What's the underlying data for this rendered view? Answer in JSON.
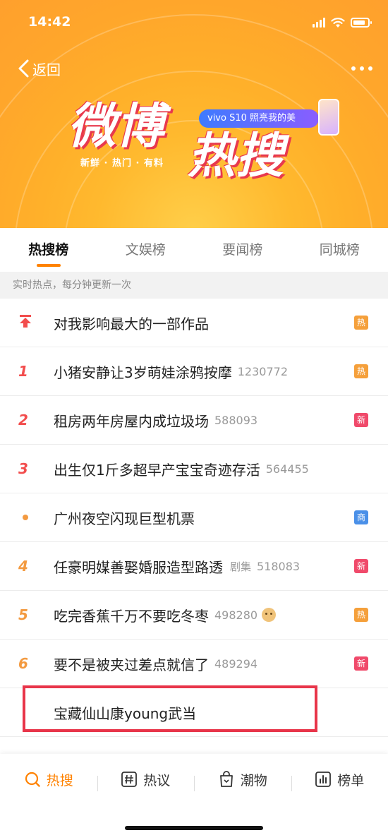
{
  "status_bar": {
    "time": "14:42"
  },
  "header": {
    "back_label": "返回",
    "logo_text_1": "微博",
    "logo_text_2": "热搜",
    "slogan": "新鲜 · 热门 · 有料",
    "ad_text": "vivo S10 照亮我的美"
  },
  "tabs": [
    {
      "label": "热搜榜",
      "active": true
    },
    {
      "label": "文娱榜",
      "active": false
    },
    {
      "label": "要闻榜",
      "active": false
    },
    {
      "label": "同城榜",
      "active": false
    }
  ],
  "subheader": "实时热点，每分钟更新一次",
  "items": [
    {
      "rank": "",
      "title": "对我影响最大的一部作品",
      "label": "",
      "count": "",
      "badge": "热",
      "badge_color": "#f5a03b"
    },
    {
      "rank": "1",
      "title": "小猪安静让3岁萌娃涂鸦按摩",
      "label": "",
      "count": "1230772",
      "badge": "热",
      "badge_color": "#f5a03b"
    },
    {
      "rank": "2",
      "title": "租房两年房屋内成垃圾场",
      "label": "",
      "count": "588093",
      "badge": "新",
      "badge_color": "#f04a6b"
    },
    {
      "rank": "3",
      "title": "出生仅1斤多超早产宝宝奇迹存活",
      "label": "",
      "count": "564455",
      "badge": "",
      "badge_color": ""
    },
    {
      "rank": "",
      "title": "广州夜空闪现巨型机票",
      "label": "",
      "count": "",
      "badge": "商",
      "badge_color": "#4a90e8"
    },
    {
      "rank": "4",
      "title": "任豪明媒善娶婚服造型路透",
      "label": "剧集",
      "count": "518083",
      "badge": "新",
      "badge_color": "#f04a6b"
    },
    {
      "rank": "5",
      "title": "吃完香蕉千万不要吃冬枣",
      "label": "",
      "count": "498280",
      "badge": "热",
      "badge_color": "#f5a03b"
    },
    {
      "rank": "6",
      "title": "要不是被夹过差点就信了",
      "label": "",
      "count": "489294",
      "badge": "新",
      "badge_color": "#f04a6b"
    },
    {
      "rank": "",
      "title": "宝藏仙山康young武当",
      "label": "",
      "count": "",
      "badge": "",
      "badge_color": ""
    }
  ],
  "bottom_nav": [
    {
      "label": "热搜",
      "icon": "search-icon",
      "active": true
    },
    {
      "label": "热议",
      "icon": "hashtag-icon",
      "active": false
    },
    {
      "label": "潮物",
      "icon": "bag-icon",
      "active": false
    },
    {
      "label": "榜单",
      "icon": "chart-icon",
      "active": false
    }
  ],
  "colors": {
    "accent": "#ff8200",
    "highlight_box": "#e8354a"
  }
}
